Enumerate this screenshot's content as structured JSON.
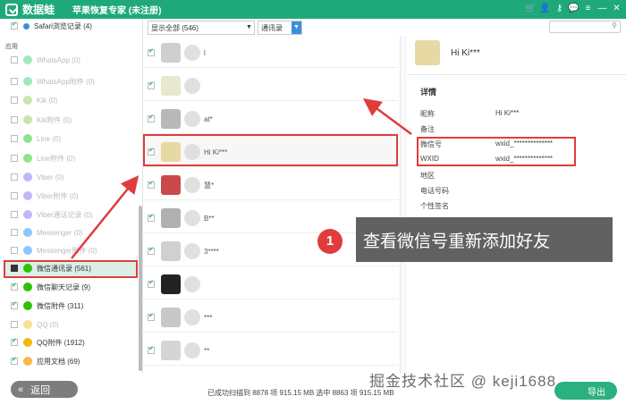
{
  "app": {
    "name": "数据蛙",
    "title": "苹果恢复专家 (未注册)"
  },
  "left": {
    "top_item": {
      "label": "Safari浏览记录 (4)"
    },
    "section": "应用",
    "items": [
      {
        "label": "WhatsApp (0)",
        "dim": true,
        "color": "#25d366"
      },
      {
        "label": "WhatsApp附件 (0)",
        "dim": true,
        "color": "#25d366"
      },
      {
        "label": "Kik (0)",
        "dim": true,
        "color": "#8bc34a"
      },
      {
        "label": "Kik附件 (0)",
        "dim": true,
        "color": "#8bc34a"
      },
      {
        "label": "Line (0)",
        "dim": true,
        "color": "#00c300"
      },
      {
        "label": "Line附件 (0)",
        "dim": true,
        "color": "#00c300"
      },
      {
        "label": "Viber (0)",
        "dim": true,
        "color": "#7360f2"
      },
      {
        "label": "Viber附件 (0)",
        "dim": true,
        "color": "#7360f2"
      },
      {
        "label": "Viber通话记录 (0)",
        "dim": true,
        "color": "#7360f2"
      },
      {
        "label": "Messenger (0)",
        "dim": true,
        "color": "#0084ff"
      },
      {
        "label": "Messenger附件 (0)",
        "dim": true,
        "color": "#0084ff"
      },
      {
        "label": "微信通讯录 (561)",
        "dim": false,
        "color": "#2dc100"
      },
      {
        "label": "微信聊天记录 (9)",
        "dim": false,
        "color": "#2dc100"
      },
      {
        "label": "微信附件 (311)",
        "dim": false,
        "color": "#2dc100"
      },
      {
        "label": "QQ (0)",
        "dim": true,
        "color": "#f0b90b"
      },
      {
        "label": "QQ附件 (1912)",
        "dim": false,
        "color": "#f0b90b"
      },
      {
        "label": "应用文档 (69)",
        "dim": false,
        "color": "#f5b946"
      }
    ],
    "back_label": "返回"
  },
  "toolbar": {
    "filter_value": "显示全部 (546)",
    "view_value": "通讯录"
  },
  "contacts": [
    {
      "name": "l",
      "color": "#cfcfcf"
    },
    {
      "name": "",
      "color": "#e8e8d0"
    },
    {
      "name": "at*",
      "color": "#b8b8b8"
    },
    {
      "name": "Hi Ki***",
      "color": "#e6d9a3"
    },
    {
      "name": "慧*",
      "color": "#c94a4a"
    },
    {
      "name": "B**",
      "color": "#b0b0b0"
    },
    {
      "name": "3****",
      "color": "#d0d0d0"
    },
    {
      "name": "",
      "color": "#222222"
    },
    {
      "name": "***",
      "color": "#c8c8c8"
    },
    {
      "name": "**",
      "color": "#d5d5d5"
    }
  ],
  "detail": {
    "name": "Hi Ki***",
    "heading": "详情",
    "fields": [
      {
        "label": "昵称",
        "value": "Hi Ki***"
      },
      {
        "label": "备注",
        "value": ""
      },
      {
        "label": "微信号",
        "value": "wxid_**************"
      },
      {
        "label": "WXID",
        "value": "wxid_**************"
      },
      {
        "label": "地区",
        "value": ""
      },
      {
        "label": "电话号码",
        "value": ""
      },
      {
        "label": "个性签名",
        "value": ""
      }
    ]
  },
  "annotation": {
    "number": "1",
    "text": "查看微信号重新添加好友"
  },
  "status": {
    "text": "已成功扫描到 8878 项 915.15 MB  选中 8863 项 915.15 MB",
    "export_label": "导出"
  },
  "watermark": "掘金技术社区 @ keji1688",
  "colors": {
    "brand": "#1fa97a",
    "highlight": "#e03c3c",
    "selected_bg": "#dcefe7"
  }
}
